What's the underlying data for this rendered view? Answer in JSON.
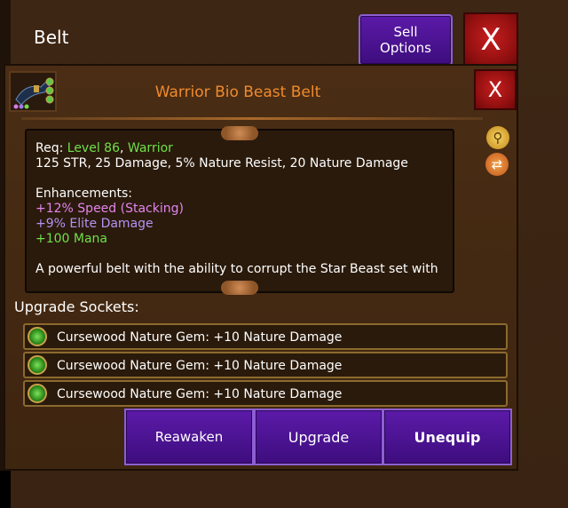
{
  "header": {
    "title": "Belt",
    "sell_label": "Sell\nOptions",
    "close_label": "X"
  },
  "item": {
    "name": "Warrior Bio Beast Belt",
    "close_label": "X",
    "req_prefix": "Req: ",
    "req_level": "Level 86",
    "req_sep": ", ",
    "req_class": "Warrior",
    "stats": "125 STR, 25 Damage, 5% Nature Resist, 20 Nature Damage",
    "enh_title": "Enhancements:",
    "enh_speed": "+12% Speed (Stacking)",
    "enh_elite": "+9% Elite Damage",
    "enh_mana": "+100 Mana",
    "description": "A powerful belt with the ability to corrupt the Star Beast set with"
  },
  "sockets": {
    "label": "Upgrade Sockets:",
    "items": [
      {
        "text": "Cursewood Nature Gem: +10 Nature Damage"
      },
      {
        "text": "Cursewood Nature Gem: +10 Nature Damage"
      },
      {
        "text": "Cursewood Nature Gem: +10 Nature Damage"
      }
    ]
  },
  "actions": {
    "reawaken": "Reawaken",
    "upgrade": "Upgrade",
    "unequip": "Unequip"
  },
  "icons": {
    "bag": "loot-bag-icon",
    "swap": "swap-icon",
    "gem": "nature-gem-icon"
  },
  "colors": {
    "accent": "#f08a2c",
    "button_purple": "#4e149a",
    "close_red": "#b01818",
    "requirement_green": "#6fe04a"
  }
}
